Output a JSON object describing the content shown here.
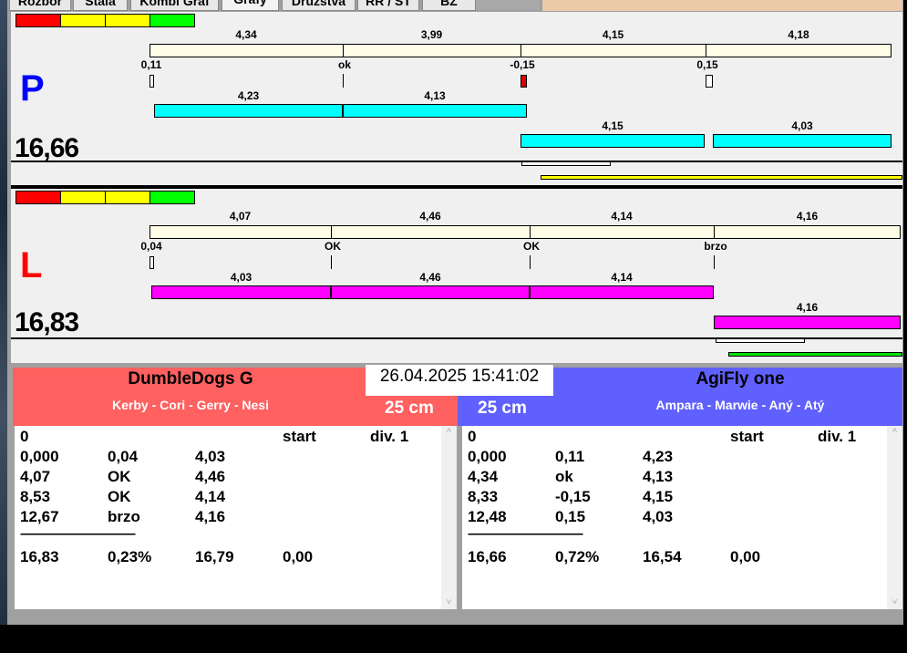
{
  "tabs": [
    "Rozbor",
    "Stala",
    "Kombi Graf",
    "Grafy",
    "Družstva",
    "RR / ST",
    "BZ"
  ],
  "selected_tab": "Grafy",
  "colors": {
    "run_p": "#00ffff",
    "run_l": "#ff00ff",
    "ref_bar": "#fffde6",
    "fault": "#e00000",
    "legend": [
      "#ff0000",
      "#ffff00",
      "#ffff00",
      "#00ff00"
    ],
    "team_left": "#ff6060",
    "team_right": "#6060ff",
    "p_label": "#0000ff",
    "l_label": "#ff0000"
  },
  "graph_p": {
    "side": "P",
    "total": "16,66",
    "top_labels": [
      "4,34",
      "3,99",
      "4,15",
      "4,18"
    ],
    "markers": [
      "0,11",
      "ok",
      "-0,15",
      "0,15"
    ],
    "run1_labels": [
      "4,23",
      "4,13"
    ],
    "run2_labels": [
      "4,15",
      "4,03"
    ]
  },
  "graph_l": {
    "side": "L",
    "total": "16,83",
    "top_labels": [
      "4,07",
      "4,46",
      "4,14",
      "4,16"
    ],
    "markers": [
      "0,04",
      "OK",
      "OK",
      "brzo"
    ],
    "run1_labels": [
      "4,03",
      "4,46",
      "4,14"
    ],
    "run2_labels": [
      "4,16"
    ]
  },
  "datetime": "26.04.2025 15:41:02",
  "teams": [
    {
      "name": "DumbleDogs G",
      "dogs": "Kerby - Cori - Gerry - Nesi",
      "height": "25 cm",
      "header": [
        "0",
        "",
        "",
        "start",
        "div. 1"
      ],
      "rows": [
        [
          "0,000",
          "0,04",
          "4,03"
        ],
        [
          "4,07",
          "OK",
          "4,46"
        ],
        [
          "8,53",
          "OK",
          "4,14"
        ],
        [
          "12,67",
          "brzo",
          "4,16"
        ]
      ],
      "separator": "----------------------------------------------",
      "totals": [
        "16,83",
        "0,23%",
        "16,79",
        "0,00"
      ]
    },
    {
      "name": "AgiFly one",
      "dogs": "Ampara - Marwie - Aný - Atý",
      "height": "25 cm",
      "header": [
        "0",
        "",
        "",
        "start",
        "div. 1"
      ],
      "rows": [
        [
          "0,000",
          "0,11",
          "4,23"
        ],
        [
          "4,34",
          "ok",
          "4,13"
        ],
        [
          "8,33",
          "-0,15",
          "4,15"
        ],
        [
          "12,48",
          "0,15",
          "4,03"
        ]
      ],
      "separator": "----------------------------------------------",
      "totals": [
        "16,66",
        "0,72%",
        "16,54",
        "0,00"
      ]
    }
  ]
}
